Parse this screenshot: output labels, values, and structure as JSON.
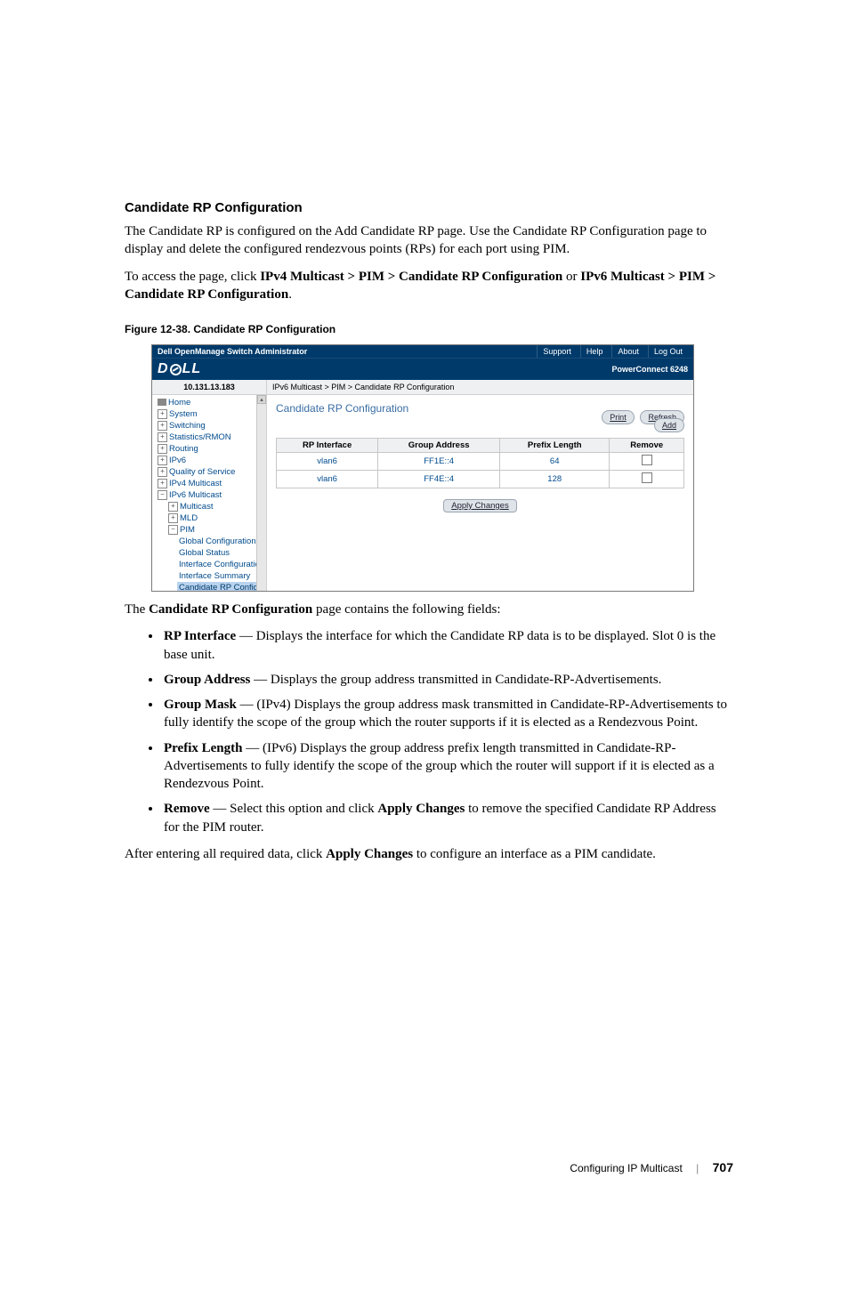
{
  "heading": "Candidate RP Configuration",
  "para1": "The Candidate RP is configured on the Add Candidate RP page. Use the Candidate RP Configuration page to display and delete the configured rendezvous points (RPs) for each port using PIM.",
  "para2_pre": "To access the page, click ",
  "para2_b1": "IPv4 Multicast > PIM > Candidate RP Configuration",
  "para2_mid": " or ",
  "para2_b2": "IPv6 Multicast > PIM > Candidate RP Configuration",
  "para2_post": ".",
  "figcap": "Figure 12-38.   Candidate RP Configuration",
  "shot": {
    "topbar_title": "Dell OpenManage Switch Administrator",
    "top_support": "Support",
    "top_help": "Help",
    "top_about": "About",
    "top_logout": "Log Out",
    "device": "PowerConnect 6248",
    "ip": "10.131.13.183",
    "breadcrumb": "IPv6 Multicast > PIM > Candidate RP Configuration",
    "nav": {
      "home": "Home",
      "system": "System",
      "switching": "Switching",
      "statsrmon": "Statistics/RMON",
      "routing": "Routing",
      "ipv6": "IPv6",
      "qos": "Quality of Service",
      "ipv4mc": "IPv4 Multicast",
      "ipv6mc": "IPv6 Multicast",
      "multicast": "Multicast",
      "mld": "MLD",
      "pim": "PIM",
      "globalconf": "Global Configuration",
      "globalstatus": "Global Status",
      "ifconf": "Interface Configuration",
      "ifsum": "Interface Summary",
      "candrp": "Candidate RP Configuration"
    },
    "panel_title": "Candidate RP Configuration",
    "btn_print": "Print",
    "btn_refresh": "Refresh",
    "btn_add": "Add",
    "th_rp": "RP Interface",
    "th_group": "Group Address",
    "th_prefix": "Prefix Length",
    "th_remove": "Remove",
    "rows": [
      {
        "iface": "vlan6",
        "group": "FF1E::4",
        "prefix": "64"
      },
      {
        "iface": "vlan6",
        "group": "FF4E::4",
        "prefix": "128"
      }
    ],
    "apply": "Apply Changes"
  },
  "intro_fields_pre": "The ",
  "intro_fields_b": "Candidate RP Configuration",
  "intro_fields_post": " page contains the following fields:",
  "fields": [
    {
      "name": "RP Interface",
      "desc": " — Displays the interface for which the Candidate RP data is to be displayed. Slot 0 is the base unit."
    },
    {
      "name": "Group Address",
      "desc": " — Displays the group address transmitted in Candidate-RP-Advertisements."
    },
    {
      "name": "Group Mask",
      "desc": " — (IPv4) Displays the group address mask transmitted in Candidate-RP-Advertisements to fully identify the scope of the group which the router supports if it is elected as a Rendezvous Point."
    },
    {
      "name": "Prefix Length",
      "desc": " — (IPv6) Displays the group address prefix length transmitted in Candidate-RP-Advertisements to fully identify the scope of the group which the router will support if it is elected as a Rendezvous Point."
    },
    {
      "name": "Remove",
      "desc_pre": " — Select this option and click ",
      "desc_b": "Apply Changes",
      "desc_post": " to remove the specified Candidate RP Address for the PIM router."
    }
  ],
  "closing_pre": "After entering all required data, click ",
  "closing_b": "Apply Changes",
  "closing_post": " to configure an interface as a PIM candidate.",
  "footer_section": "Configuring IP Multicast",
  "footer_page": "707"
}
